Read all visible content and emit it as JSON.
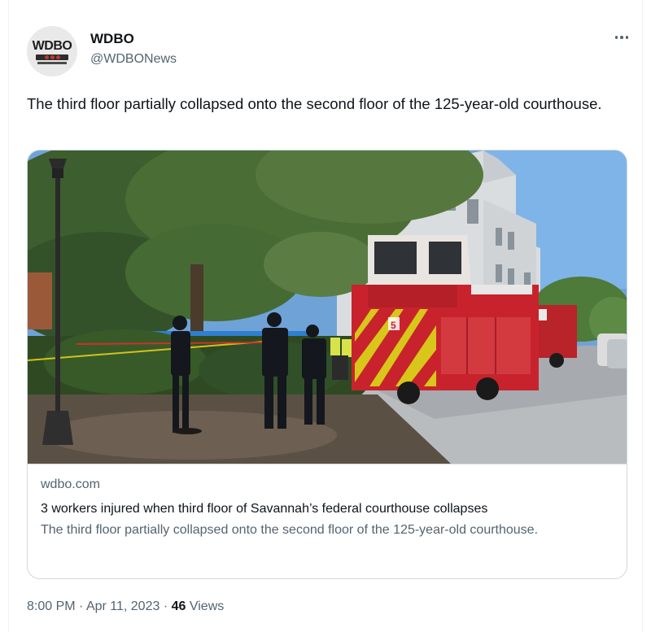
{
  "author": {
    "display_name": "WDBO",
    "handle": "@WDBONews",
    "avatar_logo": "WDBO"
  },
  "tweet": {
    "text": "The third floor partially collapsed onto the second floor of the 125-year-old courthouse."
  },
  "link_card": {
    "domain": "wdbo.com",
    "title": "3 workers injured when third floor of Savannah’s federal courthouse collapses",
    "description": "The third floor partially collapsed onto the second floor of the 125-year-old courthouse.",
    "photo_fire_truck_number": "5"
  },
  "footer": {
    "time": "8:00 PM",
    "separator": "·",
    "date": "Apr 11, 2023",
    "views_count": "46",
    "views_label": "Views"
  },
  "icons": {
    "more": "more-options-icon"
  },
  "colors": {
    "text_primary": "#0f1419",
    "text_secondary": "#536471",
    "border": "#cfd9de"
  }
}
